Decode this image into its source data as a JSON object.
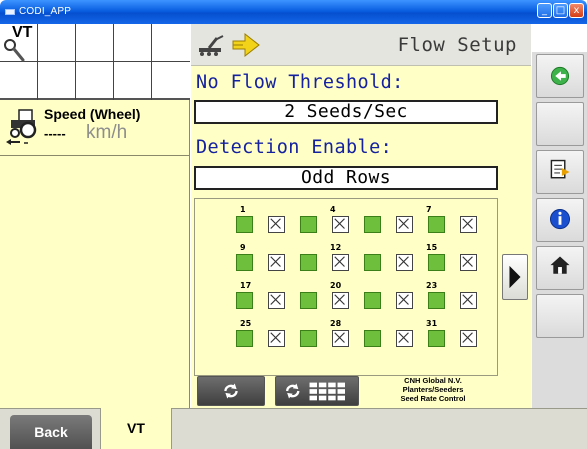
{
  "window": {
    "title": "CODI_APP",
    "controls": {
      "minimize": "_",
      "maximize": "□",
      "close": "x"
    }
  },
  "vt_panel": {
    "label": "VT"
  },
  "speed": {
    "title": "Speed (Wheel)",
    "value": "-----",
    "unit": "km/h"
  },
  "mask": {
    "title": "Flow Setup",
    "no_flow_label": "No Flow Threshold:",
    "no_flow_value": "2 Seeds/Sec",
    "detection_label": "Detection Enable:",
    "detection_value": "Odd Rows"
  },
  "row_groups": [
    {
      "labels": [
        "1",
        "4",
        "7"
      ]
    },
    {
      "labels": [
        "9",
        "12",
        "15"
      ]
    },
    {
      "labels": [
        "17",
        "20",
        "23"
      ]
    },
    {
      "labels": [
        "25",
        "28",
        "31"
      ]
    }
  ],
  "row_pattern": [
    "on",
    "off",
    "on",
    "off",
    "on",
    "off",
    "on",
    "off"
  ],
  "company": {
    "line1": "CNH Global N.V.",
    "line2": "Planters/Seeders",
    "line3": "Seed Rate Control"
  },
  "softkeys": [
    "green-circle-icon",
    "",
    "document-export-icon",
    "info-icon",
    "home-icon",
    ""
  ],
  "tabs": {
    "back": "Back",
    "vt": "VT"
  },
  "colors": {
    "panel_bg": "#ffffc6",
    "enabled_row": "#6dbf3c",
    "label_blue": "#1522a0"
  }
}
